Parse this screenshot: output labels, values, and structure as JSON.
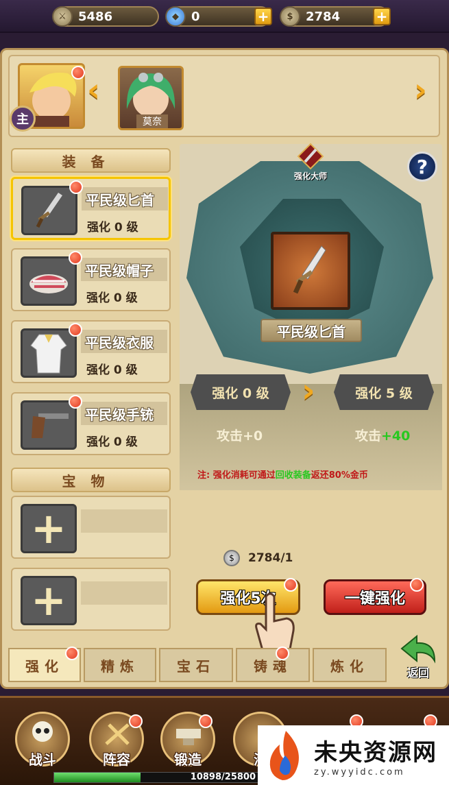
{
  "topbar": {
    "power_label": "战力",
    "power_value": "5486",
    "diamond_value": "0",
    "coin_value": "2784"
  },
  "heroes": {
    "main_badge": "主",
    "second_name": "莫奈"
  },
  "equipment": {
    "header": "装备",
    "items": [
      {
        "name": "平民级匕首",
        "level": "强化 0 级"
      },
      {
        "name": "平民级帽子",
        "level": "强化 0 级"
      },
      {
        "name": "平民级衣服",
        "level": "强化 0 级"
      },
      {
        "name": "平民级手铳",
        "level": "强化 0 级"
      }
    ]
  },
  "treasure": {
    "header": "宝物"
  },
  "enhance": {
    "master_label": "强化大师",
    "weapon_name": "平民级匕首",
    "current_level": "强化 0 级",
    "next_level": "强化 5 级",
    "attack_label": "攻击",
    "current_attack": "+0",
    "next_attack": "+40",
    "note_prefix": "注:",
    "note_a": "强化消耗可通过",
    "note_green": "回收装备",
    "note_b": "返还80%金币",
    "cost": "2784/1",
    "btn_enhance5": "强化5次",
    "btn_onekey": "一键强化"
  },
  "tabs": [
    "强化",
    "精炼",
    "宝石",
    "铸魂",
    "炼化"
  ],
  "back_label": "返回",
  "nav": {
    "items": [
      "战斗",
      "阵容",
      "锻造",
      "海"
    ],
    "progress_text": "10898/25800",
    "progress_fraction": 0.4224
  },
  "watermark": {
    "title": "未央资源网",
    "url": "zy.wyyidc.com"
  },
  "colors": {
    "accent_gold": "#f0a820",
    "note_red": "#c01818",
    "note_green": "#28c820"
  }
}
